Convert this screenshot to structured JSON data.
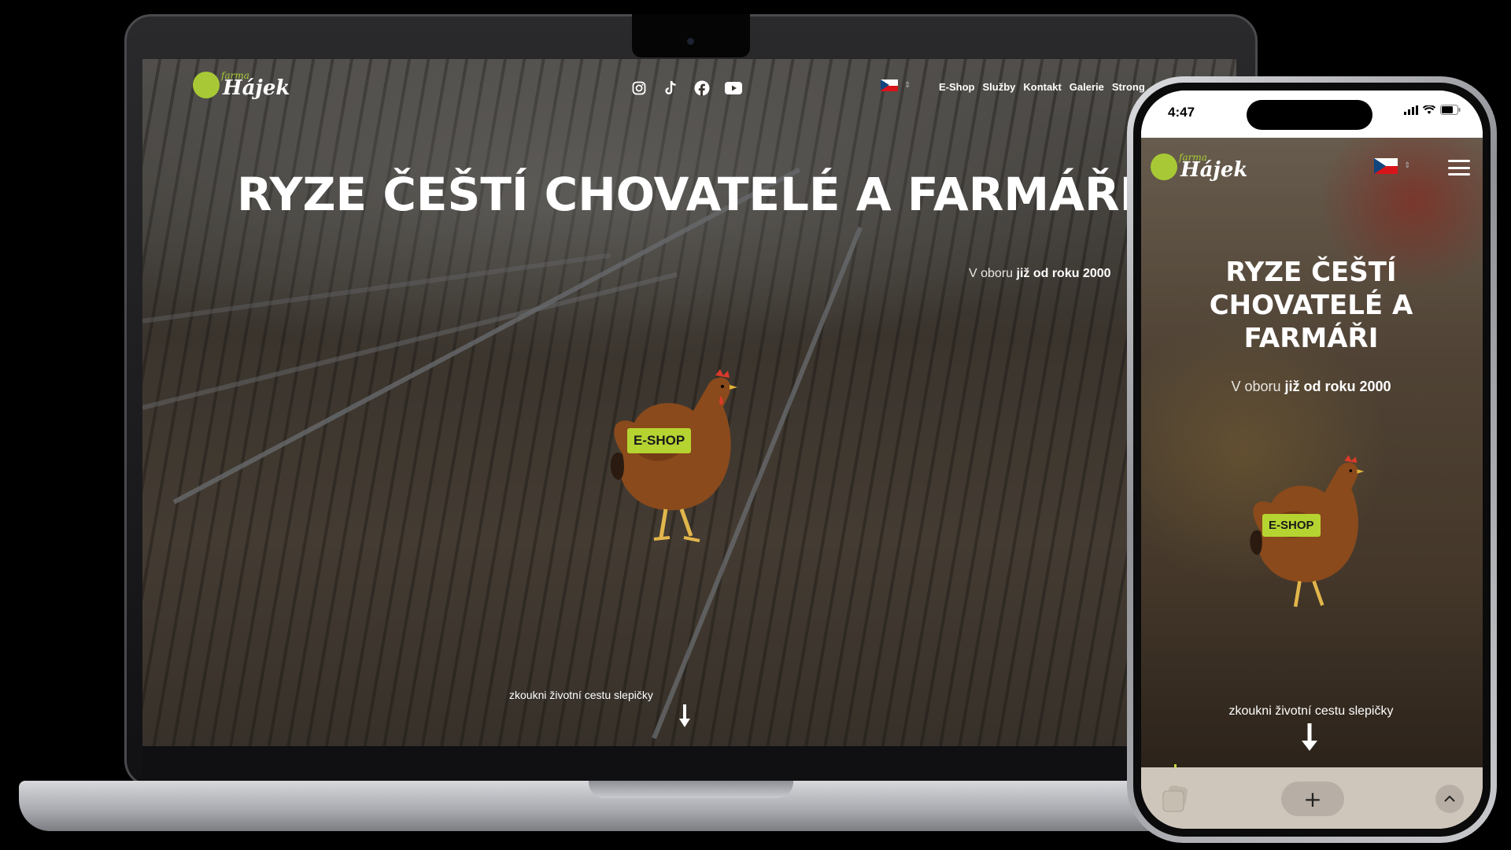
{
  "brand": {
    "logo_small": "farma",
    "logo_big": "Hájek",
    "accent_color": "#b6d431"
  },
  "laptop": {
    "social_icons": [
      "instagram-icon",
      "tiktok-icon",
      "facebook-icon",
      "youtube-icon"
    ],
    "language": "CZ",
    "nav": [
      "E-Shop",
      "Služby",
      "Kontakt",
      "Galerie",
      "Strong"
    ],
    "hero_title": "RYZE ČEŠTÍ CHOVATELÉ A FARMÁŘI",
    "hero_sub_plain": "V oboru",
    "hero_sub_bold": "již od roku 2000",
    "eshop_label": "E-SHOP",
    "cta": "zkoukni životní cestu slepičky"
  },
  "phone": {
    "time": "4:47",
    "language": "CZ",
    "hero_title": "RYZE ČEŠTÍ CHOVATELÉ A FARMÁŘI",
    "hero_sub_plain": "V oboru",
    "hero_sub_bold": "již od roku 2000",
    "eshop_label": "E-SHOP",
    "cta": "zkoukni životní cestu slepičky",
    "toolbar_plus": "+"
  }
}
